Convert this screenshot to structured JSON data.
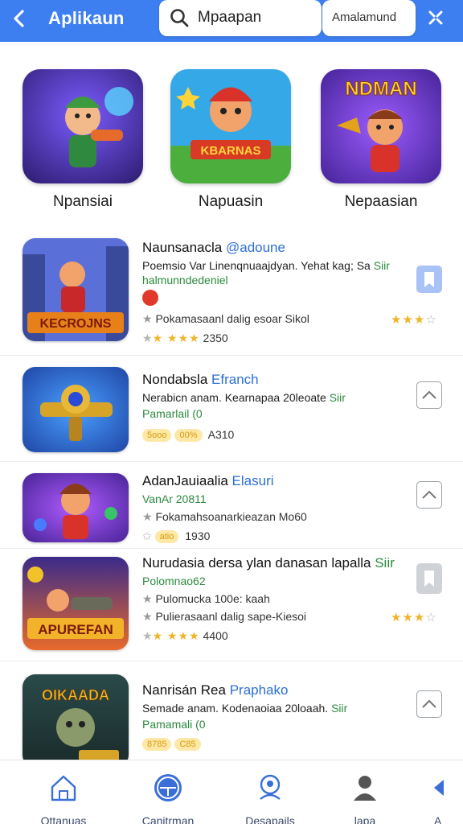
{
  "header": {
    "title": "Aplikaun",
    "back_icon": "back-arrow-icon",
    "search_placeholder": "Mpaapan",
    "search_value": "Mpaapan",
    "secondary_label": "Amalamund",
    "close_icon": "close-x-icon",
    "accent": "#3d7ef0"
  },
  "featured": [
    {
      "label": "Npansiai",
      "art": "hero-blaster"
    },
    {
      "label": "Napuasin",
      "art": "kbarnas-game"
    },
    {
      "label": "Nepaasian",
      "art": "ndman-hero"
    }
  ],
  "list": [
    {
      "name": "Naunsanacla",
      "tag": "@adoune",
      "desc": "Poemsio Var Linenqnuaajdyan. Yehat kag; Sa",
      "desc_tag": "Siir",
      "green": "halmunndedeniel",
      "meta": "Pokamasaanl dalig esoar Sikol",
      "rating_text": "2350",
      "right_stars": "★★★☆",
      "button": "bookmark"
    },
    {
      "name": "Nondabsla",
      "tag": "Efranch",
      "desc": "Nerabicn anam. Kearnapaa 20leoate",
      "desc_tag": "Siir",
      "green": "Pamarlail (0",
      "pills": [
        "5ooo",
        "00%"
      ],
      "rating_text": "A310",
      "button": "chevron-up"
    },
    {
      "name": "AdanJauiaalia",
      "tag": "Elasuri",
      "green": "VanAr 20811",
      "meta": "Fokamahsoanarkieazan Mo60",
      "pills": [
        "atio"
      ],
      "rating_text": "1930",
      "button": "chevron-up"
    },
    {
      "name": "Nurudasia dersa ylan danasan lapalla",
      "tag": "Siir",
      "green": "Polomnao62",
      "meta": "Pulomucka 100e: kaah",
      "meta2": "Pulierasaanl dalig sape-Kiesoi",
      "rating_text": "4400",
      "right_stars": "★★★☆",
      "button": "bookmark-gray"
    },
    {
      "name": "Nanrisán Rea",
      "tag": "Praphako",
      "desc": "Semade anam. Kodenaoiaa 20loaah.",
      "desc_tag": "Siir",
      "green": "Pamamali (0",
      "pills": [
        "8785",
        "C85"
      ],
      "button": "chevron-up"
    }
  ],
  "nav": [
    {
      "label": "Ottanuas",
      "icon": "home-icon"
    },
    {
      "label": "Canitrman",
      "icon": "circle-compass-icon"
    },
    {
      "label": "Desapails",
      "icon": "user-badge-icon"
    },
    {
      "label": "lapa",
      "icon": "person-icon"
    },
    {
      "label": "A",
      "icon": "arrow-icon"
    }
  ]
}
